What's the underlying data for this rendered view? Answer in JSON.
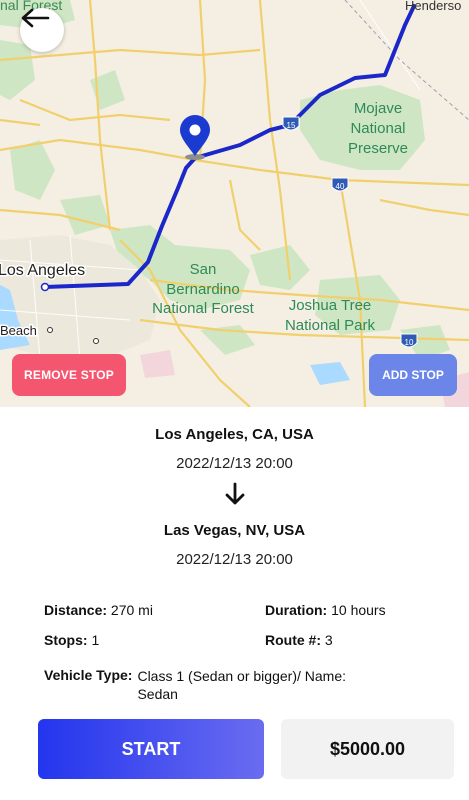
{
  "map": {
    "labels": {
      "forest_top": "nal Forest",
      "henderson": "Henderso",
      "mojave": [
        "Mojave",
        "National",
        "Preserve"
      ],
      "los_angeles": "Los Angeles",
      "beach": "Beach",
      "san_bernardino": [
        "San",
        "Bernardino",
        "National Forest"
      ],
      "joshua_tree": [
        "Joshua Tree",
        "National Park"
      ],
      "i15": "15",
      "i40": "40",
      "i10": "10"
    },
    "route_color": "#1b27c9",
    "pin_color": "#1b3bd0"
  },
  "buttons": {
    "remove_stop": "REMOVE STOP",
    "add_stop": "ADD STOP",
    "start": "START"
  },
  "trip": {
    "origin_city": "Los Angeles, CA, USA",
    "origin_datetime": "2022/12/13 20:00",
    "destination_city": "Las Vegas, NV, USA",
    "destination_datetime": "2022/12/13 20:00"
  },
  "details": {
    "distance_label": "Distance:",
    "distance_value": "270 mi",
    "duration_label": "Duration:",
    "duration_value": "10 hours",
    "stops_label": "Stops:",
    "stops_value": "1",
    "route_label": "Route #:",
    "route_value": "3",
    "vehicle_label": "Vehicle Type:",
    "vehicle_value": "Class 1 (Sedan or bigger)/ Name: Sedan"
  },
  "price": "$5000.00"
}
